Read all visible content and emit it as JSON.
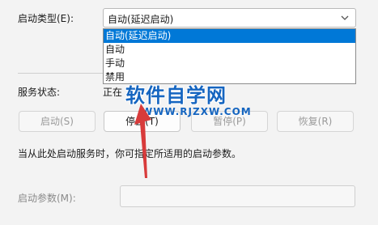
{
  "startup_type": {
    "label": "启动类型(E):",
    "selected": "自动(延迟启动)",
    "options": [
      "自动(延迟启动)",
      "自动",
      "手动",
      "禁用"
    ]
  },
  "service_status": {
    "label": "服务状态:",
    "value": "正在"
  },
  "buttons": {
    "start": "启动(S)",
    "stop": "停止(T)",
    "pause": "暂停(P)",
    "resume": "恢复(R)"
  },
  "hint": "当从此处启动服务时，你可指定所适用的启动参数。",
  "params": {
    "label": "启动参数(M):",
    "value": ""
  },
  "watermark": {
    "title": "软件自学网",
    "url": "WWW.RJZXW.COM"
  },
  "colors": {
    "selection": "#0078d7",
    "watermark": "#1565c0",
    "arrow": "#d83b3b"
  }
}
